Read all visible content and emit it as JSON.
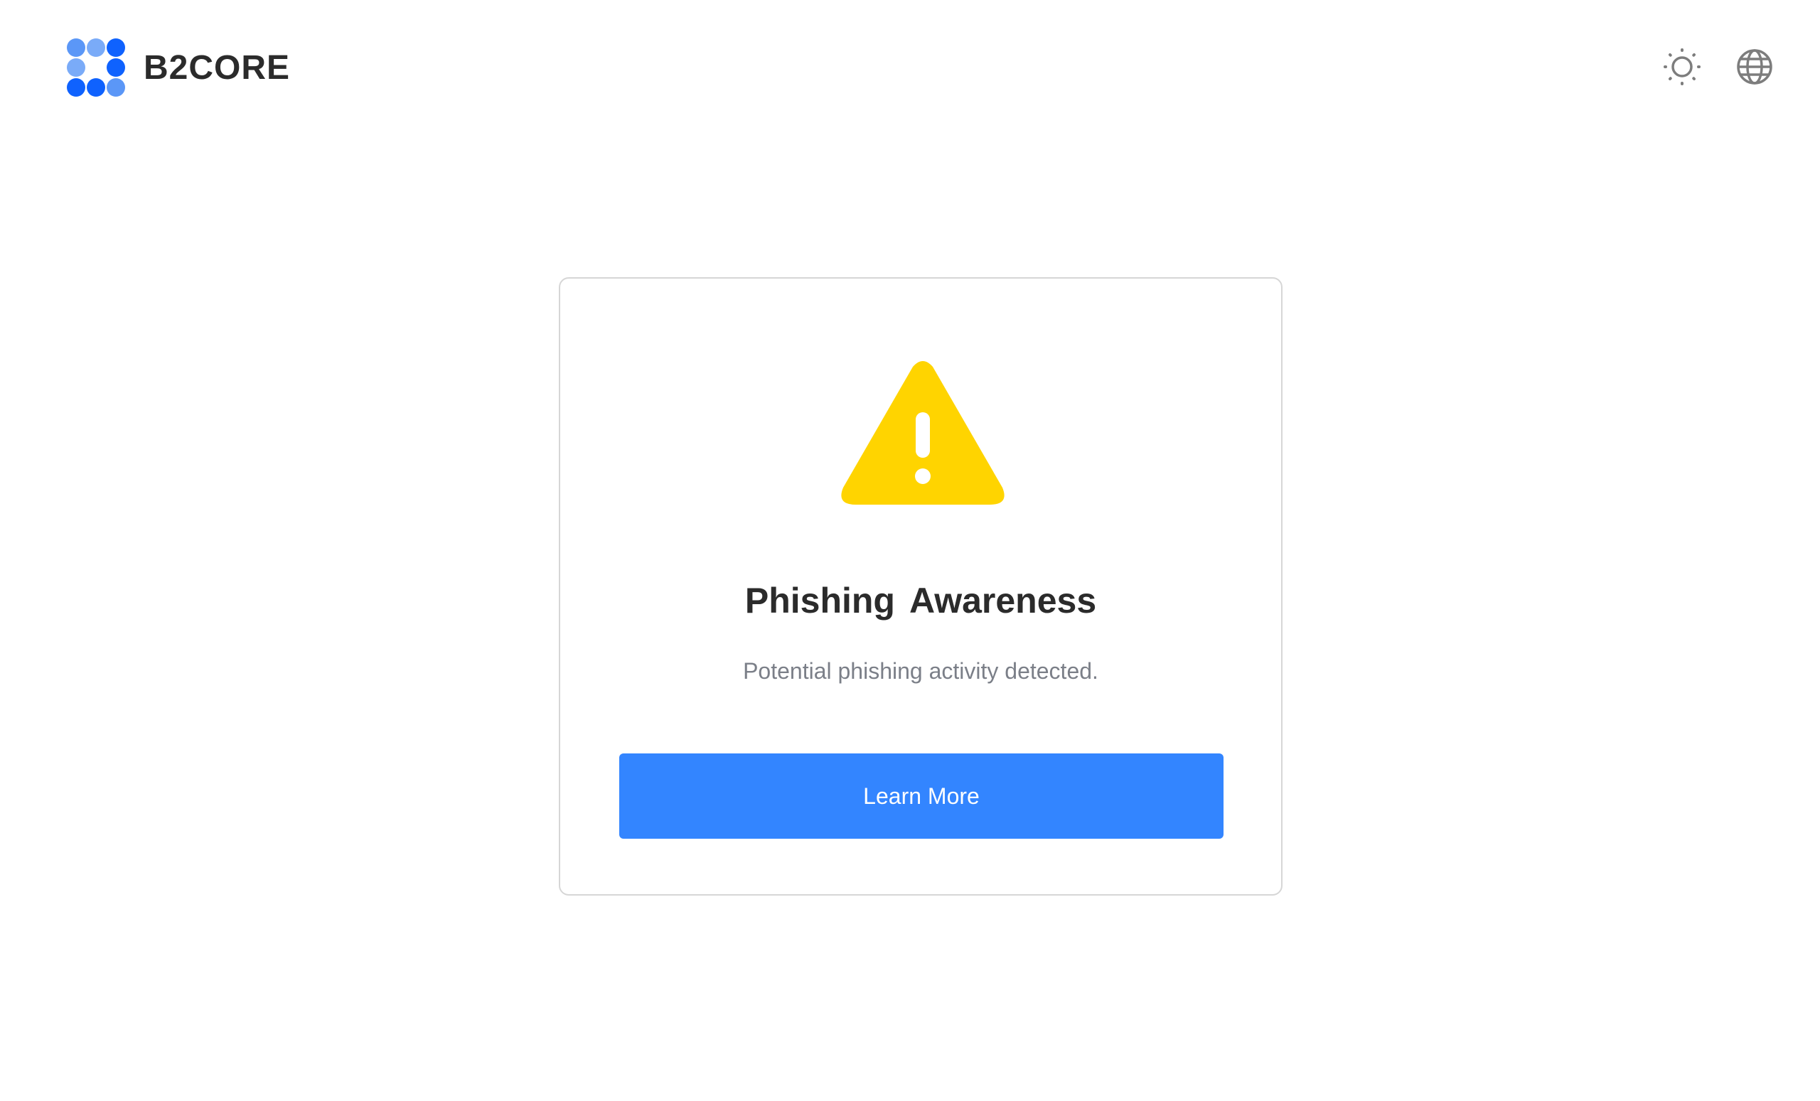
{
  "header": {
    "brand": "B2CORE",
    "logo_icon": "b2core-dots-logo-icon",
    "theme_toggle_icon": "sun-icon",
    "language_icon": "globe-icon"
  },
  "card": {
    "icon": "warning-triangle-icon",
    "title": "Phishing Awareness",
    "subtitle": "Potential phishing activity detected.",
    "button_label": "Learn More"
  },
  "colors": {
    "accent": "#3385ff",
    "warning": "#ffd400",
    "logo_dark": "#0f62fe",
    "logo_light": "#5b97f7",
    "text_primary": "#2b2b2b",
    "text_muted": "#7b7f88",
    "icon_gray": "#7d7d7d",
    "border": "#d6d6d6"
  }
}
